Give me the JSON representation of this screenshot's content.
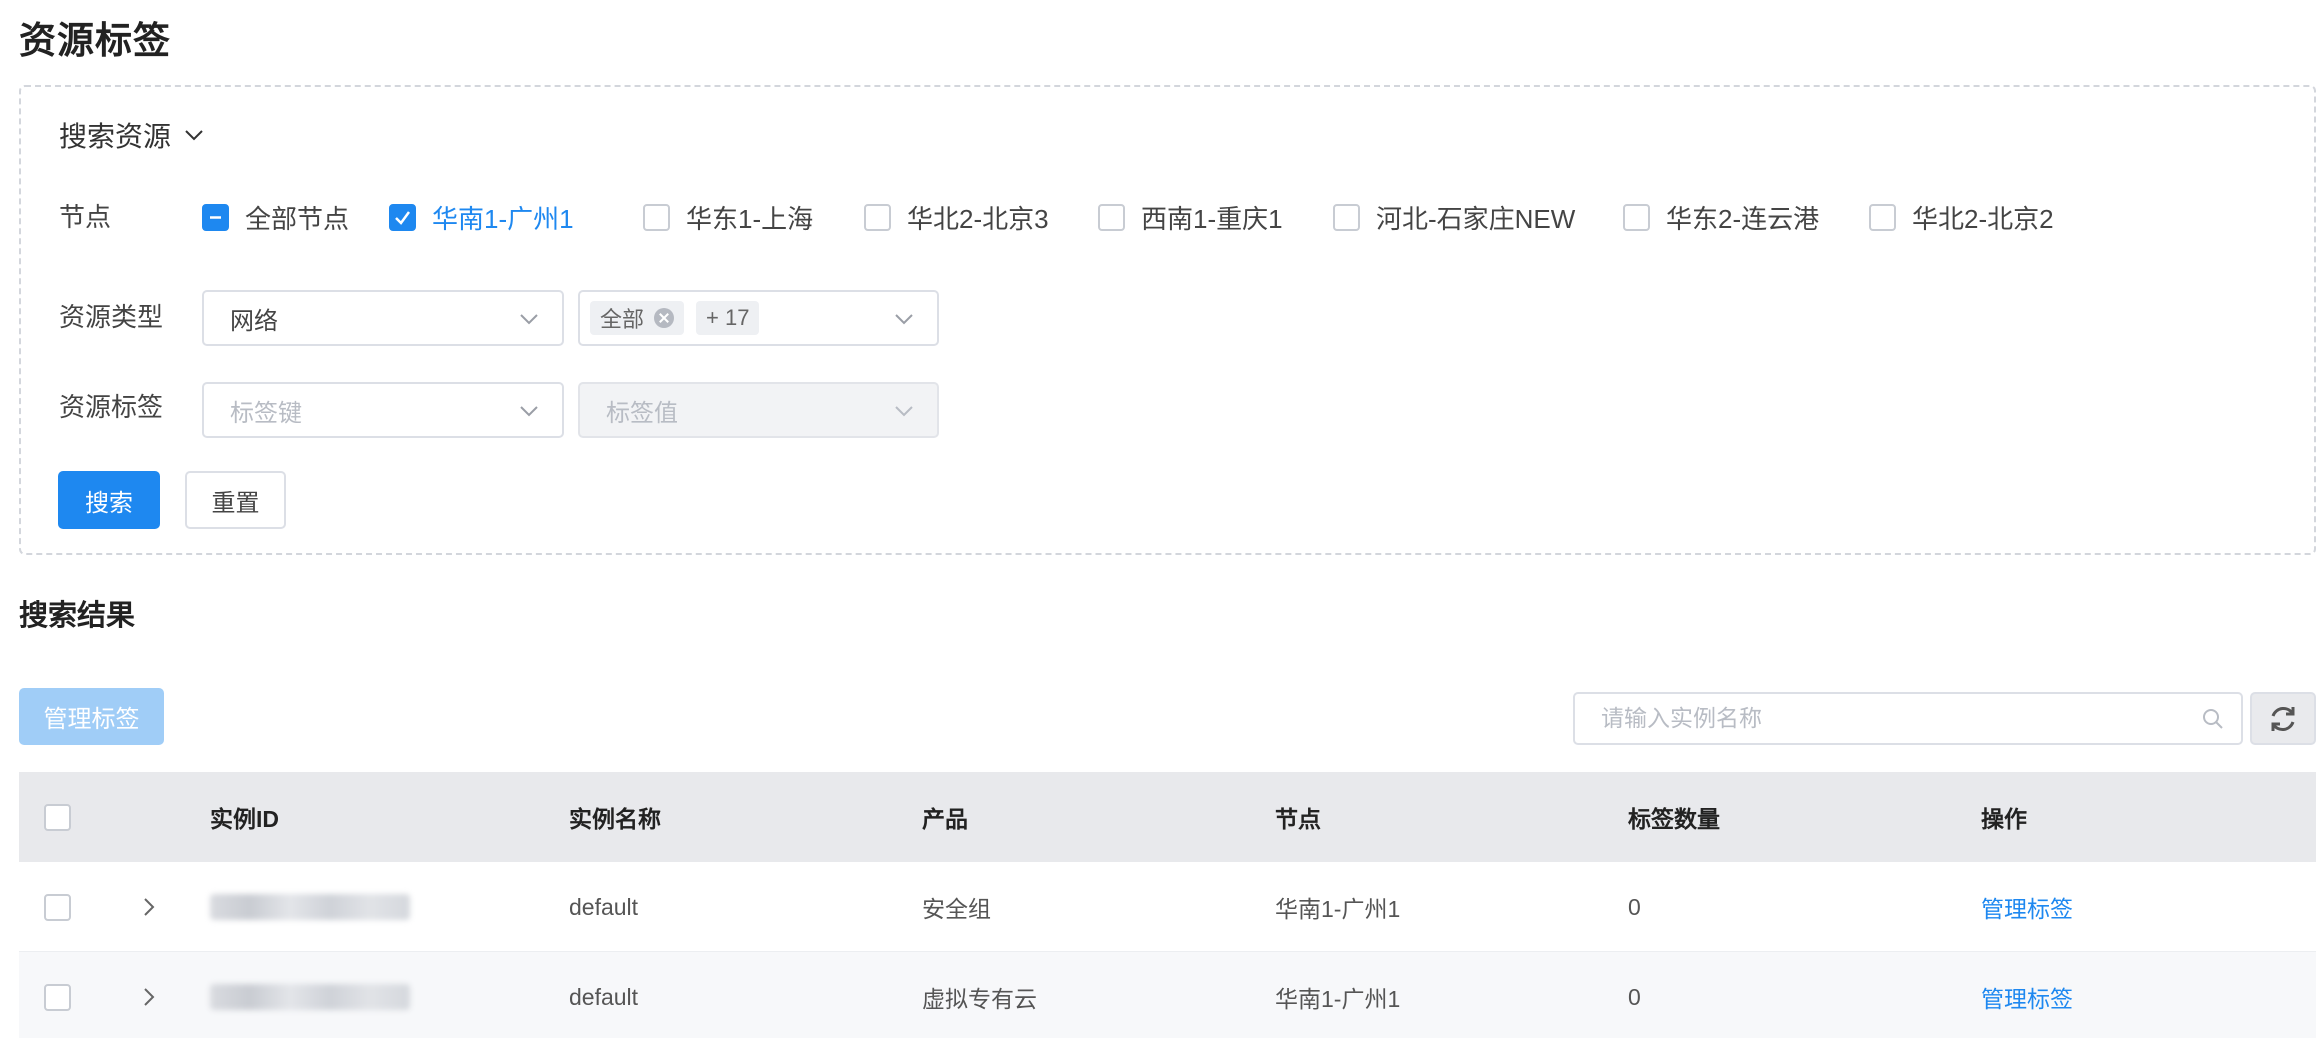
{
  "page": {
    "title": "资源标签"
  },
  "search_panel": {
    "toggle_label": "搜索资源",
    "node_label": "节点",
    "nodes": [
      {
        "label": "全部节点",
        "state": "indeterminate"
      },
      {
        "label": "华南1-广州1",
        "state": "checked"
      },
      {
        "label": "华东1-上海",
        "state": "unchecked"
      },
      {
        "label": "华北2-北京3",
        "state": "unchecked"
      },
      {
        "label": "西南1-重庆1",
        "state": "unchecked"
      },
      {
        "label": "河北-石家庄NEW",
        "state": "unchecked"
      },
      {
        "label": "华东2-连云港",
        "state": "unchecked"
      },
      {
        "label": "华北2-北京2",
        "state": "unchecked"
      }
    ],
    "resource_type_label": "资源类型",
    "resource_type_value": "网络",
    "resource_subtype_tag": "全部",
    "resource_subtype_more": "+ 17",
    "resource_tag_label": "资源标签",
    "tag_key_placeholder": "标签键",
    "tag_value_placeholder": "标签值",
    "search_button": "搜索",
    "reset_button": "重置"
  },
  "results": {
    "title": "搜索结果",
    "manage_tags_button": "管理标签",
    "search_placeholder": "请输入实例名称",
    "columns": [
      "实例ID",
      "实例名称",
      "产品",
      "节点",
      "标签数量",
      "操作"
    ],
    "rows": [
      {
        "name": "default",
        "product": "安全组",
        "node": "华南1-广州1",
        "tag_count": "0",
        "action": "管理标签"
      },
      {
        "name": "default",
        "product": "虚拟专有云",
        "node": "华南1-广州1",
        "tag_count": "0",
        "action": "管理标签"
      }
    ]
  },
  "colors": {
    "primary": "#1e88f0",
    "primary_disabled": "#a0cdf7",
    "header_bg": "#e8e9ec"
  }
}
